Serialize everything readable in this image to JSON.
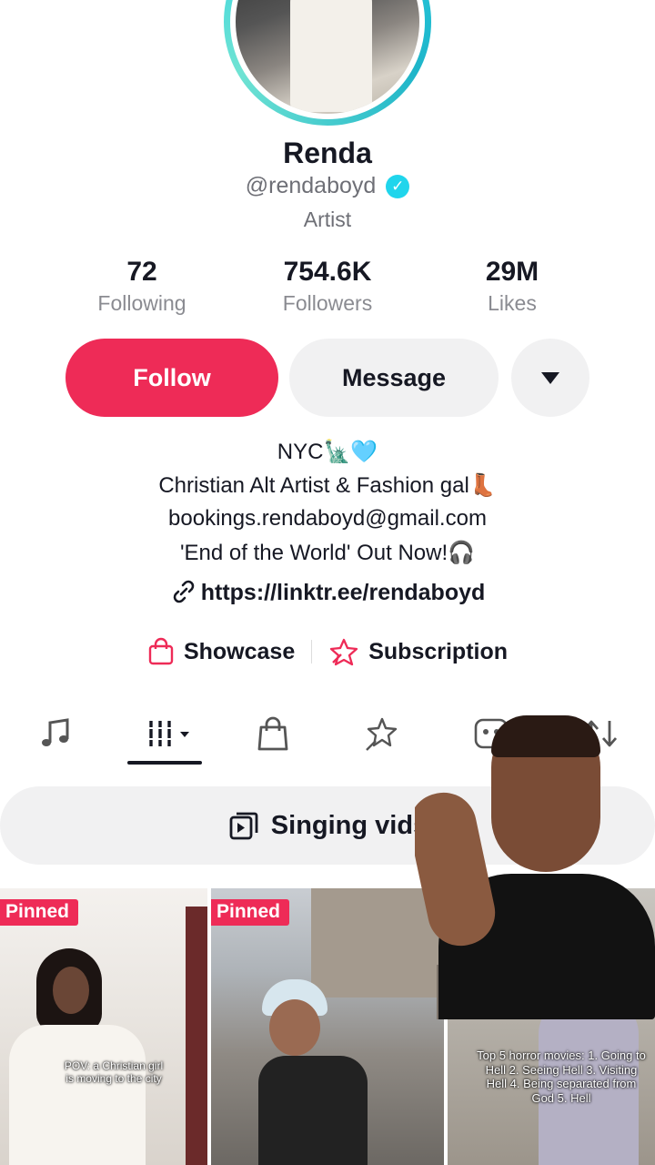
{
  "profile": {
    "name": "Renda",
    "handle": "@rendaboyd",
    "role": "Artist"
  },
  "stats": [
    {
      "value": "72",
      "label": "Following"
    },
    {
      "value": "754.6K",
      "label": "Followers"
    },
    {
      "value": "29M",
      "label": "Likes"
    }
  ],
  "actions": {
    "follow_label": "Follow",
    "message_label": "Message"
  },
  "bio": {
    "line1": "NYC🗽🩵",
    "line2": "Christian Alt Artist & Fashion gal👢",
    "line3": "bookings.rendaboyd@gmail.com",
    "line4": "'End of the World' Out Now!🎧",
    "link": "https://linktr.ee/rendaboyd"
  },
  "shortcuts": {
    "showcase_label": "Showcase",
    "subscription_label": "Subscription"
  },
  "playlist": {
    "label": "Singing vids"
  },
  "videos": [
    {
      "badge": "Pinned",
      "caption": "POV: a Christian girl is moving to the city"
    },
    {
      "badge": "Pinned",
      "caption": ""
    },
    {
      "badge": "",
      "caption": "Top 5 horror movies: 1. Going to Hell 2. Seeing Hell 3. Visiting Hell 4. Being separated from God 5. Hell"
    }
  ],
  "colors": {
    "accent": "#ee2b57",
    "verified": "#20d5ec",
    "avatar_ring": "#25d0e6"
  }
}
